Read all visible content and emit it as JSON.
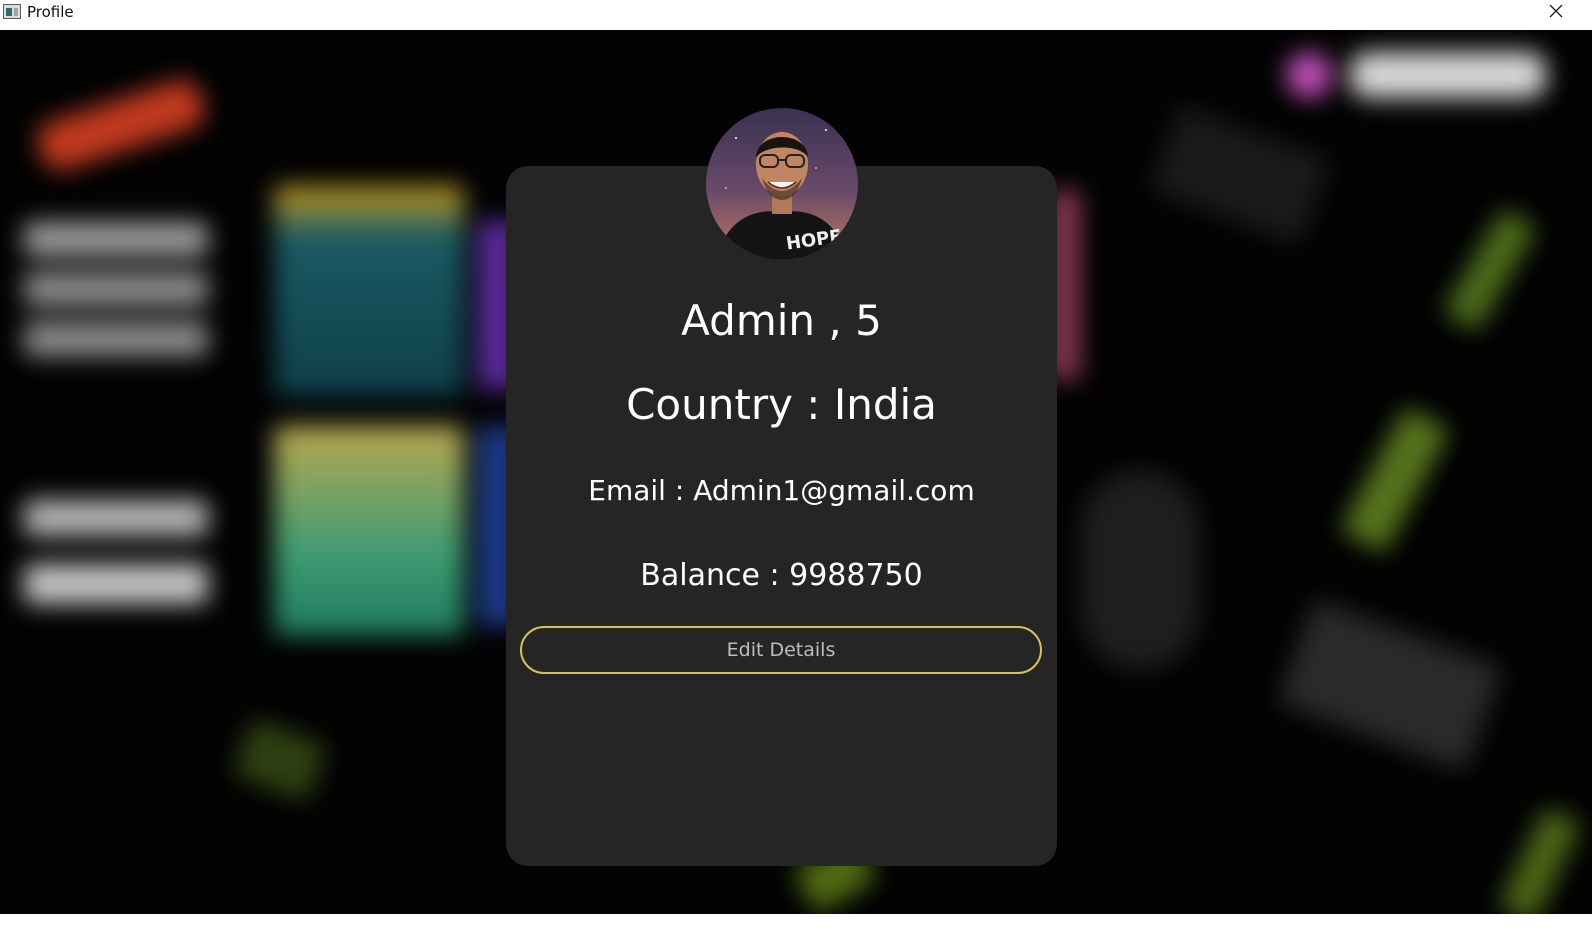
{
  "window": {
    "title": "Profile",
    "close_icon": "close-icon",
    "app_icon": "app-window-icon"
  },
  "profile": {
    "name_line": "Admin , 5",
    "country_line": "Country : India",
    "email_line": "Email : Admin1@gmail.com",
    "balance_line": "Balance : 9988750",
    "edit_button_label": "Edit Details"
  },
  "colors": {
    "card_background": "#252525",
    "button_border": "#d6c25a",
    "page_background": "#030303"
  }
}
